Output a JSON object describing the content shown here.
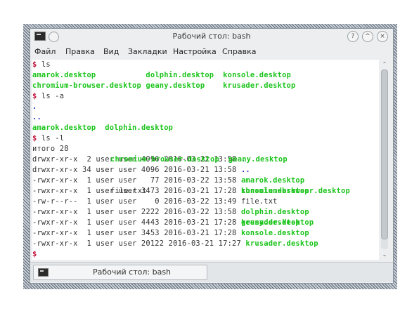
{
  "window": {
    "title": "Рабочий стол: bash"
  },
  "window_buttons": {
    "help": "?",
    "minimize": "^",
    "close": "×"
  },
  "menu": {
    "items": [
      "Файл",
      "Правка",
      "Вид",
      "Закладки",
      "Настройка",
      "Справка"
    ]
  },
  "terminal": {
    "lines": [
      [
        {
          "t": "$ ",
          "c": "r"
        },
        {
          "t": "ls",
          "c": "d"
        }
      ],
      [
        {
          "t": "amarok.desktop           ",
          "c": "g"
        },
        {
          "t": "dolphin.desktop  ",
          "c": "g"
        },
        {
          "t": "konsole.desktop",
          "c": "g"
        }
      ],
      [
        {
          "t": "chromium-browser.desktop ",
          "c": "g"
        },
        {
          "t": "geany.desktop    ",
          "c": "g"
        },
        {
          "t": "krusader.desktop",
          "c": "g"
        }
      ],
      [
        {
          "t": "$ ",
          "c": "r"
        },
        {
          "t": "ls -a",
          "c": "d"
        }
      ],
      [
        {
          "t": ".",
          "c": "b"
        }
      ],
      [
        {
          "t": "..                 ",
          "c": "b"
        },
        {
          "t": "",
          "c": "d"
        }
      ],
      [
        {
          "t": "amarok.desktop  ",
          "c": "g"
        },
        {
          "t": "dolphin.desktop",
          "c": "g"
        }
      ],
      [
        {
          "t": "$ ",
          "c": "r"
        },
        {
          "t": "ls -l",
          "c": "d"
        }
      ],
      [
        {
          "t": "итого 28",
          "c": "d"
        }
      ],
      [
        {
          "t": "drwxr-xr-x  2 user user 4096 2016-03-22 13:58 ",
          "c": "d"
        },
        {
          "t": ".",
          "c": "b"
        }
      ],
      [
        {
          "t": "drwxr-xr-x 34 user user 4096 2016-03-21 13:58 ",
          "c": "d"
        },
        {
          "t": "..",
          "c": "b"
        }
      ],
      [
        {
          "t": "-rwxr-xr-x  1 user user   77 2016-03-22 13:58 ",
          "c": "d"
        },
        {
          "t": "amarok.desktop",
          "c": "g"
        }
      ],
      [
        {
          "t": "-rwxr-xr-x  1 user user 3473 2016-03-21 17:28 ",
          "c": "d"
        },
        {
          "t": "chromium-browser.desktop",
          "c": "g"
        }
      ],
      [
        {
          "t": "-rw-r--r--  1 user user    0 2016-03-22 13:49 ",
          "c": "d"
        },
        {
          "t": "file.txt",
          "c": "d"
        }
      ],
      [
        {
          "t": "-rwxr-xr-x  1 user user 2222 2016-03-22 13:58 ",
          "c": "d"
        },
        {
          "t": "dolphin.desktop",
          "c": "g"
        }
      ],
      [
        {
          "t": "-rwxr-xr-x  1 user user 4443 2016-03-21 17:28 ",
          "c": "d"
        },
        {
          "t": "geany.desktop",
          "c": "g"
        }
      ],
      [
        {
          "t": "-rwxr-xr-x  1 user user 3453 2016-03-21 17:28 ",
          "c": "d"
        },
        {
          "t": "konsole.desktop",
          "c": "g"
        }
      ],
      [
        {
          "t": "-rwxr-xr-x  1 user user 20122 2016-03-21 17:27 ",
          "c": "d"
        },
        {
          "t": "krusader.desktop",
          "c": "g"
        }
      ],
      [
        {
          "t": "$ ",
          "c": "r"
        }
      ]
    ],
    "overlay_line_5": {
      "col2": "chromium-browser.desktop  ",
      "col3": "geany.desktop"
    },
    "overlay_line_6": {
      "col2": "file.txt",
      "col3": "konsole.desktop"
    },
    "overlay_line_7": {
      "col3": "krusader.desktop"
    }
  },
  "scrollbar": {
    "up": "⌃",
    "down": "⌄"
  },
  "tab": {
    "label": "Рабочий стол: bash"
  },
  "colors": {
    "green": "#1cc41c",
    "blue": "#2030c8",
    "prompt": "#c0143c"
  }
}
